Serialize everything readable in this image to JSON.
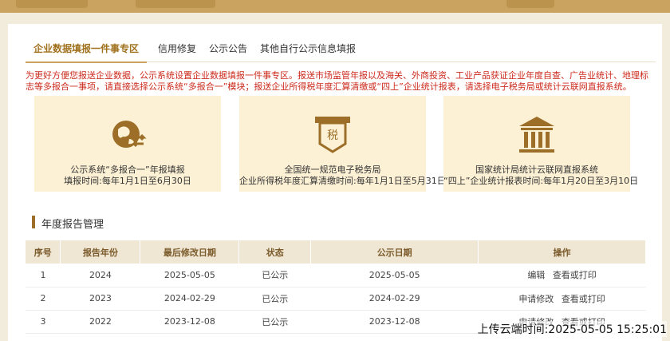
{
  "tabs": [
    {
      "label": "企业数据填报一件事专区"
    },
    {
      "label": "信用修复"
    },
    {
      "label": "公示公告"
    },
    {
      "label": "其他自行公示信息填报"
    }
  ],
  "notice": "为更好方便您报送企业数据，公示系统设置企业数据填报一件事专区。报送市场监管年报以及海关、外商投资、工业产品获证企业年度自查、广告业统计、地理标志等多报合一事项，请直接选择公示系统“多报合一”模块；报送企业所得税年度汇算清缴或“四上”企业统计报表，请选择电子税务局或统计云联网直报系统。",
  "cards": [
    {
      "line1": "公示系统“多报合一”年报填报",
      "line2": "填报时间:每年1月1日至6月30日",
      "icon": "globe-arrows-icon"
    },
    {
      "line1": "全国统一规范电子税务局",
      "line2": "企业所得税年度汇算清缴时间:每年1月1日至5月31日",
      "icon": "tax-seal-icon"
    },
    {
      "line1": "国家统计局统计云联网直报系统",
      "line2": "“四上”企业统计报表时间:每年1月20日至3月10日",
      "icon": "government-building-icon"
    }
  ],
  "section_title": "年度报告管理",
  "table": {
    "headers": [
      "序号",
      "报告年份",
      "最后修改日期",
      "状态",
      "公示日期",
      "操作"
    ],
    "rows": [
      {
        "no": "1",
        "year": "2024",
        "modified": "2025-05-05",
        "status": "已公示",
        "published": "2025-05-05",
        "actions": [
          "编辑",
          "查看或打印"
        ]
      },
      {
        "no": "2",
        "year": "2023",
        "modified": "2024-02-29",
        "status": "已公示",
        "published": "2024-02-29",
        "actions": [
          "申请修改",
          "查看或打印"
        ]
      },
      {
        "no": "3",
        "year": "2022",
        "modified": "2023-12-08",
        "status": "已公示",
        "published": "2023-12-08",
        "actions": [
          "申请修改",
          "查看或打印"
        ]
      }
    ]
  },
  "timestamp": "上传云端时间:2025-05-05 15:25:01",
  "colors": {
    "accent": "#c9a35f",
    "notice": "#cc2a1c",
    "card_bg": "#fdf1d5",
    "icon": "#9c6e28"
  }
}
